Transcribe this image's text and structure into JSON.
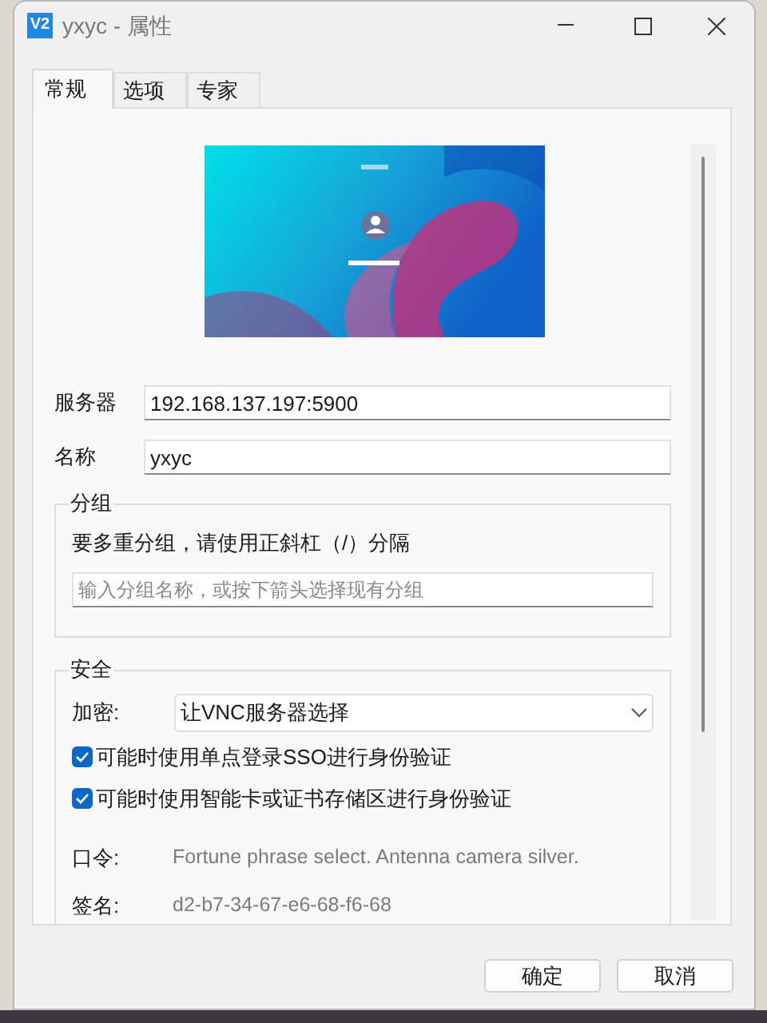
{
  "window": {
    "title": "yxyc - 属性",
    "logo": "V2"
  },
  "tabs": [
    {
      "label": "常规",
      "selected": true
    },
    {
      "label": "选项",
      "selected": false
    },
    {
      "label": "专家",
      "selected": false
    }
  ],
  "preview": {
    "kind": "picture"
  },
  "fields": [
    {
      "label": "服务器",
      "value": "192.168.137.197:5900"
    },
    {
      "label": "名称",
      "value": "yxyc"
    }
  ],
  "group": {
    "title": "分组",
    "hint": "要多重分组，请使用正斜杠（/）分隔",
    "placeholder": "输入分组名称，或按下箭头选择现有分组"
  },
  "security": {
    "title": "安全",
    "encryption_label": "加密:",
    "encryption_value": "让VNC服务器选择",
    "checkboxes": [
      {
        "label": "可能时使用单点登录SSO进行身份验证",
        "checked": true
      },
      {
        "label": "可能时使用智能卡或证书存储区进行身份验证",
        "checked": true
      }
    ],
    "info": [
      {
        "label": "口令:",
        "value": "Fortune phrase select. Antenna camera silver."
      },
      {
        "label": "签名:",
        "value": "d2-b7-34-67-e6-68-f6-68"
      }
    ]
  },
  "buttons": [
    "确定",
    "取消"
  ]
}
